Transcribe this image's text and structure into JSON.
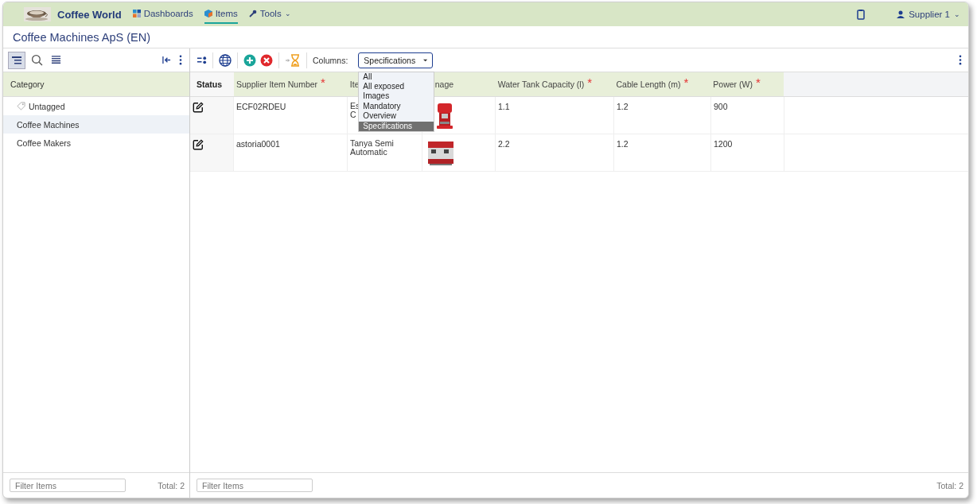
{
  "app": {
    "name": "Coffee World"
  },
  "nav": [
    {
      "label": "Dashboards",
      "selected": false
    },
    {
      "label": "Items",
      "selected": true
    },
    {
      "label": "Tools",
      "selected": false,
      "caret": "⌄"
    }
  ],
  "user": {
    "label": "Supplier 1",
    "caret": "⌄"
  },
  "page_title": "Coffee Machines ApS (EN)",
  "sidebar": {
    "header": "Category",
    "items": [
      {
        "label": "Untagged",
        "tag": true,
        "selected": false
      },
      {
        "label": "Coffee Machines",
        "tag": false,
        "selected": true
      },
      {
        "label": "Coffee Makers",
        "tag": false,
        "selected": false
      }
    ],
    "filter_placeholder": "Filter Items",
    "total": "Total: 2"
  },
  "toolbar": {
    "columns_label": "Columns:",
    "columns_value": "Specifications",
    "options": [
      {
        "label": "All",
        "selected": false
      },
      {
        "label": "All exposed",
        "selected": false
      },
      {
        "label": "Images",
        "selected": false
      },
      {
        "label": "Mandatory",
        "selected": false
      },
      {
        "label": "Overview",
        "selected": false
      },
      {
        "label": "Specifications",
        "selected": true
      }
    ]
  },
  "table": {
    "columns": [
      {
        "label": "Status"
      },
      {
        "label": "Supplier Item Number",
        "required": "*"
      },
      {
        "label": "Ite"
      },
      {
        "label": "nage"
      },
      {
        "label": "Water Tank Capacity (l)",
        "required": "*"
      },
      {
        "label": "Cable Length (m)",
        "required": "*"
      },
      {
        "label": "Power (W)",
        "required": "*"
      }
    ],
    "rows": [
      {
        "number": "ECF02RDEU",
        "item": [
          "Es",
          "C"
        ],
        "water": "1.1",
        "cable": "1.2",
        "power": "900"
      },
      {
        "number": "astoria0001",
        "item": [
          "Tanya Semi",
          "Automatic"
        ],
        "water": "2.2",
        "cable": "1.2",
        "power": "1200"
      }
    ],
    "filter_placeholder": "Filter Items",
    "total": "Total: 2"
  }
}
